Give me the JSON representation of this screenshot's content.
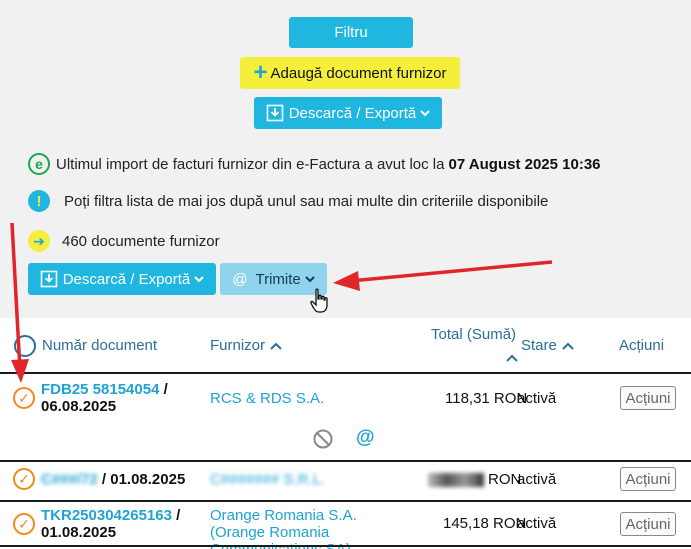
{
  "toolbar": {
    "filter_label": "Filtru",
    "add_label": "Adaugă document furnizor",
    "export_label": "Descarcă / Exportă",
    "send_label": "Trimite"
  },
  "info": {
    "import_prefix": "Ultimul import de facturi furnizor din e-Factura a avut loc la",
    "import_date": "07 August 2025 10:36",
    "filter_hint": "Poți filtra lista de mai jos după unul sau mai multe din criteriile disponibile",
    "doc_count": "460 documente furnizor"
  },
  "table": {
    "headers": {
      "doc_number": "Număr document",
      "supplier": "Furnizor",
      "total": "Total (Sumă)",
      "status": "Stare",
      "actions": "Acțiuni"
    },
    "rows": [
      {
        "doc_link": "FDB25 58154054",
        "doc_sep": " /",
        "doc_date": "06.08.2025",
        "supplier": "RCS & RDS S.A.",
        "total": "118,31 RON",
        "status": "activă",
        "action": "Acțiuni"
      },
      {
        "doc_link": "C###/72",
        "doc_sep": " / 01.08.2025",
        "doc_date": "",
        "supplier": "C####### S.R.L.",
        "total": "RON",
        "status": "activă",
        "action": "Acțiuni"
      },
      {
        "doc_link": "TKR250304265163",
        "doc_sep": " /",
        "doc_date": "01.08.2025",
        "supplier": "Orange Romania S.A. (Orange Romania Communications SA)",
        "total": "145,18 RON",
        "status": "activă",
        "action": "Acțiuni"
      }
    ]
  },
  "colors": {
    "cyan": "#1fb7e0",
    "yellow": "#f5ef3c",
    "orange": "#f08a1c",
    "link": "#1fa3d4",
    "header": "#2a6f99",
    "annotation_arrow": "#e0262b"
  }
}
